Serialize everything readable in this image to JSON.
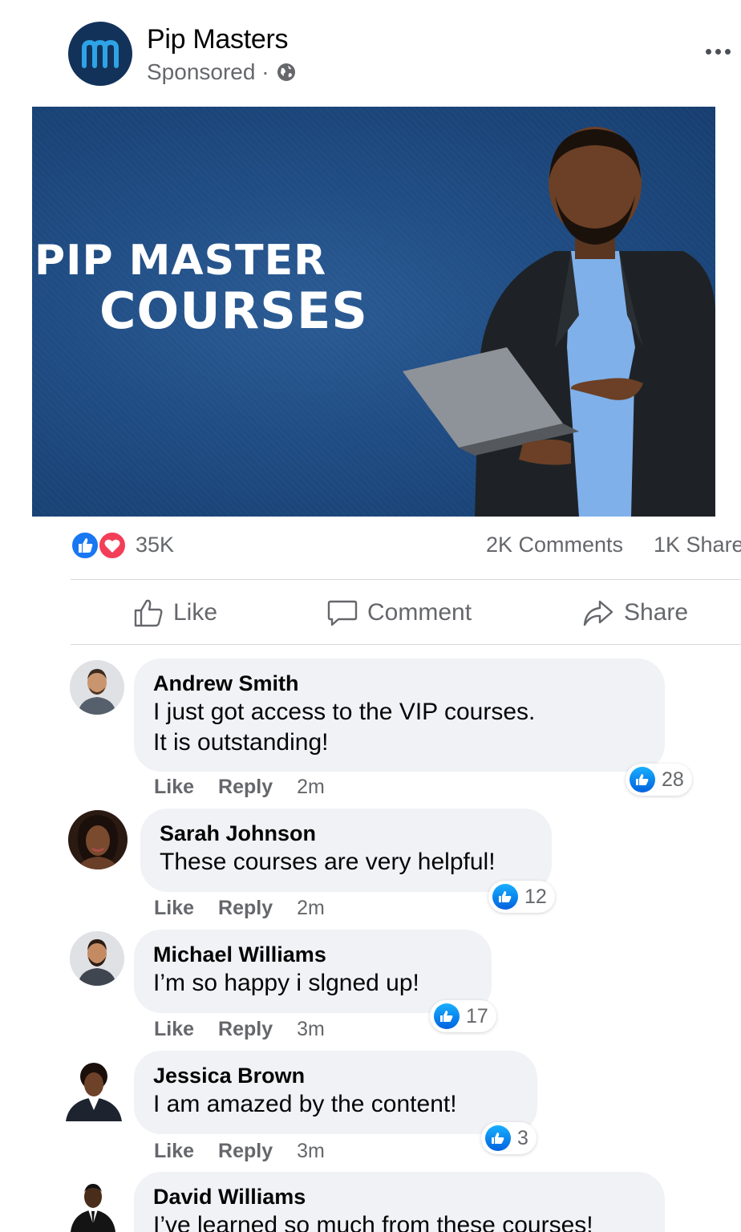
{
  "post": {
    "page_name": "Pip Masters",
    "sponsored": "Sponsored ·",
    "icons": {
      "avatar": "pip-masters-logo",
      "audience": "globe-icon",
      "more": "more-options-icon"
    }
  },
  "ad": {
    "title_line1": "PIP MASTER",
    "title_line2": "COURSES",
    "background_color": "#1f4c83"
  },
  "stats": {
    "reactions": "35K",
    "comments": "2K Comments",
    "shares": "1K Share"
  },
  "actions": {
    "like": "Like",
    "comment": "Comment",
    "share": "Share"
  },
  "comments": [
    {
      "name": "Andrew Smith",
      "lines": [
        "I just got access to the VIP courses.",
        "It is outstanding!"
      ],
      "like_label": "Like",
      "reply_label": "Reply",
      "time": "2m",
      "likes": "28"
    },
    {
      "name": "Sarah Johnson",
      "lines": [
        "These courses are very helpful!"
      ],
      "like_label": "Like",
      "reply_label": "Reply",
      "time": "2m",
      "likes": "12"
    },
    {
      "name": "Michael Williams",
      "lines": [
        "I’m so happy i slgned up!"
      ],
      "like_label": "Like",
      "reply_label": "Reply",
      "time": "3m",
      "likes": "17"
    },
    {
      "name": "Jessica Brown",
      "lines": [
        "I am amazed by the content!"
      ],
      "like_label": "Like",
      "reply_label": "Reply",
      "time": "3m",
      "likes": "3"
    },
    {
      "name": "David Williams",
      "lines": [
        "I’ve learned so much from these courses!"
      ]
    }
  ],
  "colors": {
    "like_blue": "#1877f2",
    "love_red": "#f33e58",
    "secondary_text": "#65676b",
    "bubble_bg": "#f0f2f5"
  }
}
